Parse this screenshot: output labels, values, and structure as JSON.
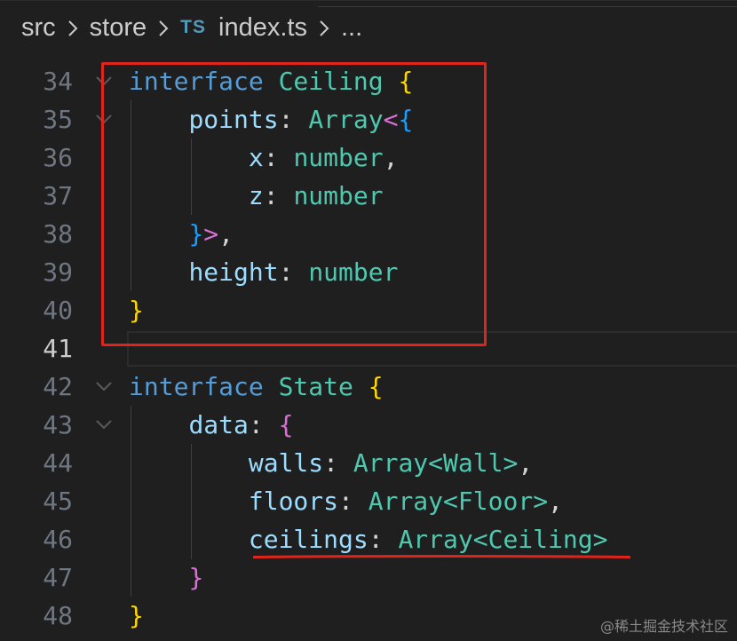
{
  "breadcrumb": {
    "items": [
      "src",
      "store",
      "index.ts",
      "..."
    ],
    "file_badge": "TS",
    "separator_icon": "chevron-right-icon"
  },
  "editor": {
    "lines": [
      {
        "number": "34",
        "active": false,
        "fold": true
      },
      {
        "number": "35",
        "active": false,
        "fold": true
      },
      {
        "number": "36",
        "active": false,
        "fold": false
      },
      {
        "number": "37",
        "active": false,
        "fold": false
      },
      {
        "number": "38",
        "active": false,
        "fold": false
      },
      {
        "number": "39",
        "active": false,
        "fold": false
      },
      {
        "number": "40",
        "active": false,
        "fold": false
      },
      {
        "number": "41",
        "active": true,
        "fold": false
      },
      {
        "number": "42",
        "active": false,
        "fold": true
      },
      {
        "number": "43",
        "active": false,
        "fold": true
      },
      {
        "number": "44",
        "active": false,
        "fold": false
      },
      {
        "number": "45",
        "active": false,
        "fold": false
      },
      {
        "number": "46",
        "active": false,
        "fold": false
      },
      {
        "number": "47",
        "active": false,
        "fold": false
      },
      {
        "number": "48",
        "active": false,
        "fold": false
      }
    ],
    "code": {
      "l34": {
        "kw": "interface",
        "name": "Ceiling",
        "brace": "{"
      },
      "l35": {
        "prop": "points",
        "colon": ":",
        "type": "Array",
        "lt": "<",
        "brace": "{"
      },
      "l36": {
        "prop": "x",
        "colon": ":",
        "type": "number",
        "comma": ","
      },
      "l37": {
        "prop": "z",
        "colon": ":",
        "type": "number"
      },
      "l38": {
        "brace": "}",
        "gt": ">",
        "comma": ","
      },
      "l39": {
        "prop": "height",
        "colon": ":",
        "type": "number"
      },
      "l40": {
        "brace": "}"
      },
      "l42": {
        "kw": "interface",
        "name": "State",
        "brace": "{"
      },
      "l43": {
        "prop": "data",
        "colon": ":",
        "brace": "{"
      },
      "l44": {
        "prop": "walls",
        "colon": ":",
        "type": "Array",
        "lt": "<",
        "arg": "Wall",
        "gt": ">",
        "comma": ","
      },
      "l45": {
        "prop": "floors",
        "colon": ":",
        "type": "Array",
        "lt": "<",
        "arg": "Floor",
        "gt": ">",
        "comma": ","
      },
      "l46": {
        "prop": "ceilings",
        "colon": ":",
        "type": "Array",
        "lt": "<",
        "arg": "Ceiling",
        "gt": ">"
      },
      "l47": {
        "brace": "}"
      },
      "l48": {
        "brace": "}"
      }
    }
  },
  "annotations": {
    "box_color": "#e0241b",
    "underline_color": "#e0241b"
  },
  "colors": {
    "background": "#1f1f1f",
    "keyword": "#569cd6",
    "type": "#4ec9b0",
    "property": "#9cdcfe",
    "bracket_level1": "#ffd700",
    "bracket_level2": "#da70d6",
    "bracket_level3": "#179fff"
  },
  "watermark": "@稀土掘金技术社区"
}
